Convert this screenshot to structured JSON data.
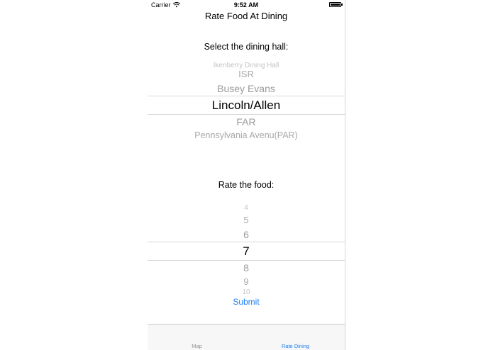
{
  "status_bar": {
    "carrier": "Carrier",
    "time": "9:52 AM",
    "wifi_icon": "wifi-icon",
    "battery_icon": "battery-icon"
  },
  "nav": {
    "title": "Rate Food At Dining"
  },
  "dining": {
    "label": "Select the dining hall:",
    "options": [
      "Ikenberry Dining Hall",
      "ISR",
      "Busey Evans",
      "Lincoln/Allen",
      "FAR",
      "Pennsylvania Avenu(PAR)"
    ],
    "selected": "Lincoln/Allen"
  },
  "rating": {
    "label": "Rate the food:",
    "options": [
      "4",
      "5",
      "6",
      "7",
      "8",
      "9",
      "10"
    ],
    "selected": "7"
  },
  "submit_label": "Submit",
  "tab_bar": {
    "tabs": [
      {
        "label": "Map",
        "active": false
      },
      {
        "label": "Rate Dining",
        "active": true
      }
    ]
  },
  "colors": {
    "accent": "#1a7ef5",
    "picker_text_inactive": "#9a9a9a",
    "tab_inactive": "#929292"
  }
}
